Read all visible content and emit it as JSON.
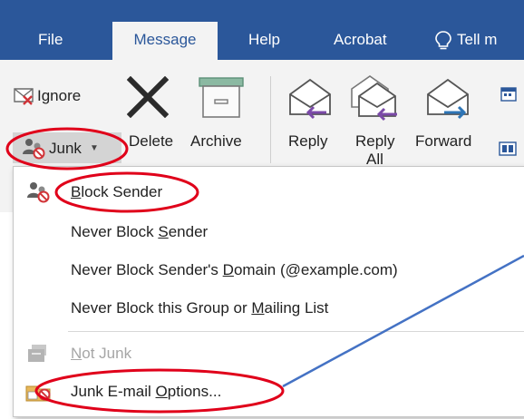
{
  "tabs": [
    {
      "label": "File"
    },
    {
      "label": "Message"
    },
    {
      "label": "Help"
    },
    {
      "label": "Acrobat"
    },
    {
      "label": "Tell m"
    }
  ],
  "ribbon": {
    "ignore_label": "Ignore",
    "junk_label": "Junk",
    "delete_label": "Delete",
    "archive_label": "Archive",
    "reply_label": "Reply",
    "reply_all_line1": "Reply",
    "reply_all_line2": "All",
    "forward_label": "Forward"
  },
  "junk_menu": {
    "items": [
      {
        "pre": "",
        "u": "B",
        "post": "lock Sender",
        "icon": "block-sender-icon"
      },
      {
        "pre": "Never Block ",
        "u": "S",
        "post": "ender"
      },
      {
        "pre": "Never Block Sender's ",
        "u": "D",
        "post": "omain (@example.com)"
      },
      {
        "pre": "Never Block this Group or ",
        "u": "M",
        "post": "ailing List"
      },
      {
        "pre": "",
        "u": "N",
        "post": "ot Junk",
        "icon": "not-junk-icon",
        "disabled": true
      },
      {
        "pre": "Junk E-mail ",
        "u": "O",
        "post": "ptions...",
        "icon": "junk-options-icon"
      }
    ]
  },
  "background_fragments": [
    "F",
    "r",
    "p",
    "r"
  ],
  "colors": {
    "tabbar": "#2b579a",
    "ribbon": "#f3f3f3",
    "annotation_red": "#e0001a",
    "annotation_line": "#4472c4"
  }
}
